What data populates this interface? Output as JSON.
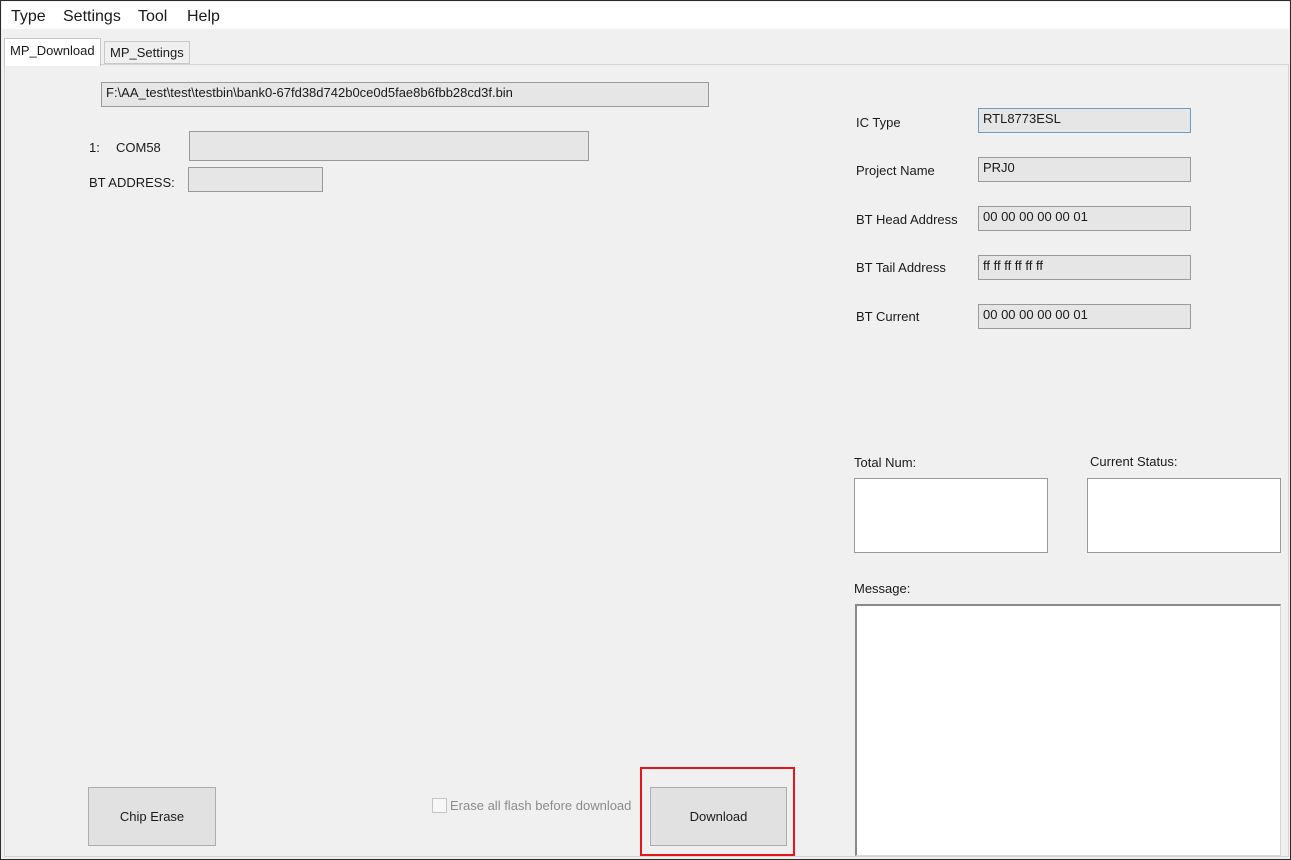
{
  "menu": [
    "Type",
    "Settings",
    "Tool",
    "Help"
  ],
  "tabs": [
    "MP_Download",
    "MP_Settings"
  ],
  "file_path": "F:\\AA_test\\test\\testbin\\bank0-67fd38d742b0ce0d5fae8b6fbb28cd3f.bin",
  "port": {
    "index": "1:",
    "name": "COM58",
    "progress_value": ""
  },
  "bt_address": {
    "label": "BT ADDRESS:",
    "value": ""
  },
  "info": {
    "ic_type_label": "IC Type",
    "ic_type_value": "RTL8773ESL",
    "project_name_label": "Project Name",
    "project_name_value": "PRJ0",
    "bt_head_label": "BT Head Address",
    "bt_head_value": "00 00 00 00 00 01",
    "bt_tail_label": "BT Tail Address",
    "bt_tail_value": "ff ff ff ff ff ff",
    "bt_current_label": "BT Current",
    "bt_current_value": "00 00 00 00 00 01"
  },
  "total_num_label": "Total Num:",
  "current_status_label": "Current Status:",
  "message_label": "Message:",
  "buttons": {
    "chip_erase": "Chip Erase",
    "download": "Download"
  },
  "erase_all_label": "Erase all flash before download",
  "colors": {
    "highlight": "#e8141b",
    "focus_border": "#6d9cc1"
  }
}
